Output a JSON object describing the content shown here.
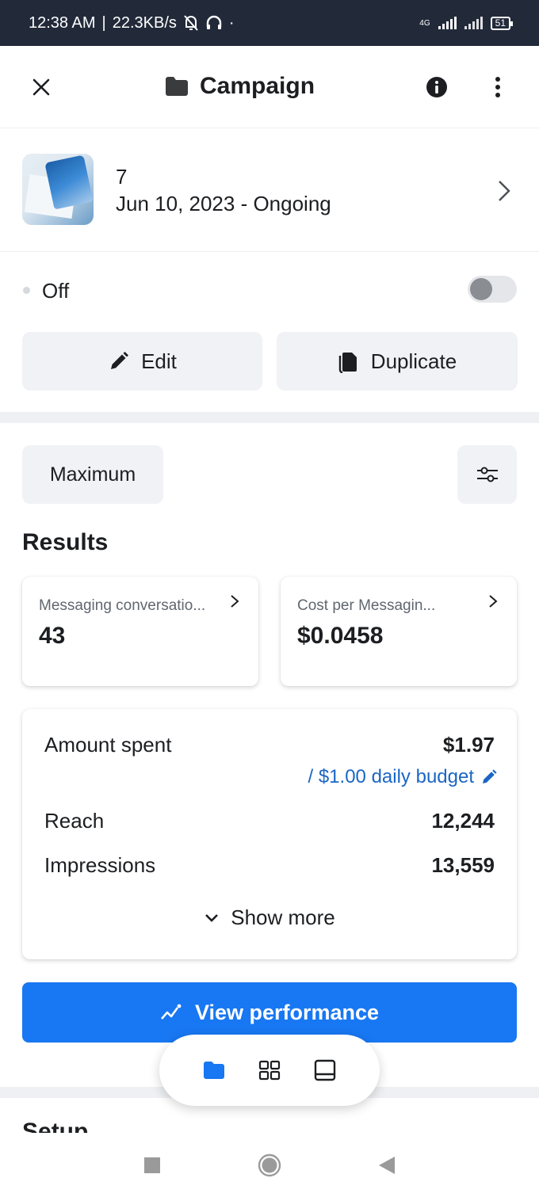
{
  "status_bar": {
    "time": "12:38 AM",
    "network_speed": "22.3KB/s",
    "network_type": "4G",
    "battery": "51"
  },
  "header": {
    "title": "Campaign"
  },
  "campaign": {
    "name": "7",
    "dates": "Jun 10, 2023 -  Ongoing"
  },
  "status": {
    "label": "Off",
    "toggle_on": false
  },
  "actions": {
    "edit_label": "Edit",
    "duplicate_label": "Duplicate"
  },
  "filter": {
    "range_label": "Maximum"
  },
  "results": {
    "title": "Results",
    "metrics": [
      {
        "label": "Messaging conversatio...",
        "value": "43"
      },
      {
        "label": "Cost per Messagin...",
        "value": "$0.0458"
      }
    ]
  },
  "summary": {
    "amount_spent_label": "Amount spent",
    "amount_spent_value": "$1.97",
    "budget_text": "/ $1.00 daily budget",
    "reach_label": "Reach",
    "reach_value": "12,244",
    "impressions_label": "Impressions",
    "impressions_value": "13,559",
    "show_more_label": "Show more"
  },
  "view_performance_label": "View performance",
  "setup_title": "Setup",
  "colors": {
    "accent": "#1877f2",
    "link": "#1a66c4",
    "status_bar": "#222a3a"
  }
}
